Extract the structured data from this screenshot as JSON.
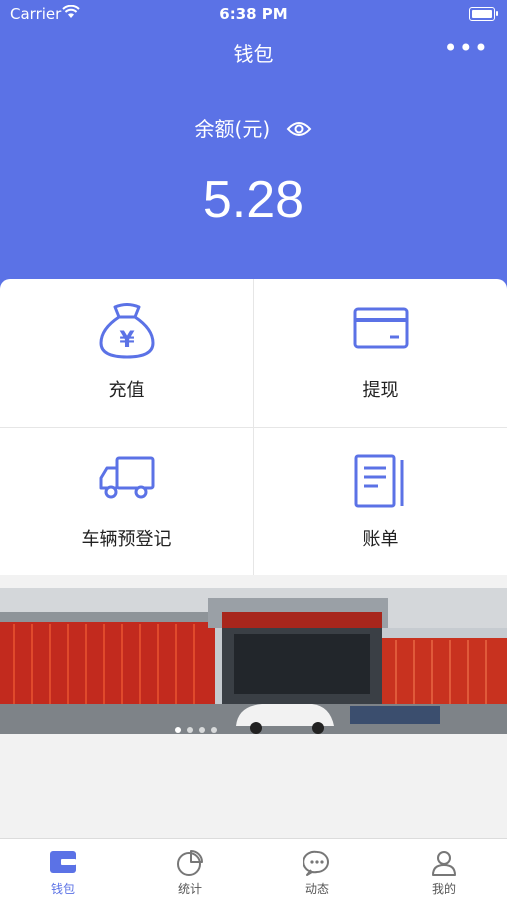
{
  "status_bar": {
    "carrier": "Carrier",
    "time": "6:38 PM"
  },
  "nav": {
    "title": "钱包",
    "more": "•••"
  },
  "balance": {
    "label": "余额(元)",
    "amount": "5.28"
  },
  "grid": [
    {
      "label": "充值",
      "icon": "money-bag-icon"
    },
    {
      "label": "提现",
      "icon": "card-icon"
    },
    {
      "label": "车辆预登记",
      "icon": "truck-icon"
    },
    {
      "label": "账单",
      "icon": "bill-icon"
    }
  ],
  "banner": {
    "slides": 4,
    "active_slide": 0
  },
  "tabs": [
    {
      "label": "钱包",
      "icon": "wallet-icon",
      "active": true
    },
    {
      "label": "统计",
      "icon": "pie-chart-icon",
      "active": false
    },
    {
      "label": "动态",
      "icon": "chat-icon",
      "active": false
    },
    {
      "label": "我的",
      "icon": "user-icon",
      "active": false
    }
  ],
  "colors": {
    "primary": "#5b72e6",
    "background": "#f2f2f2"
  }
}
